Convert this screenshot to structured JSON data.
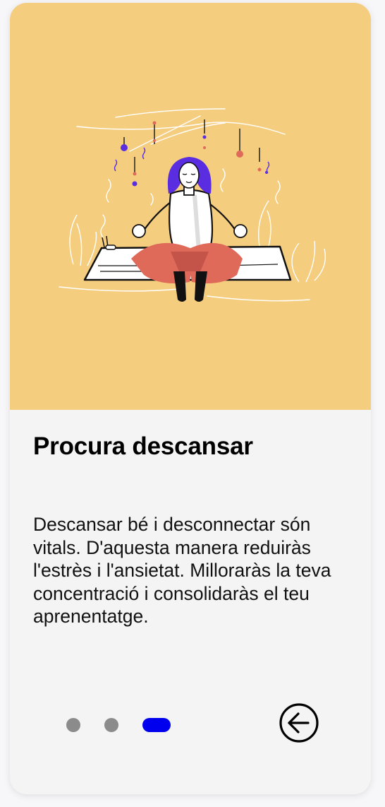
{
  "slide": {
    "title": "Procura descansar",
    "description": "Descansar bé i desconnectar són vitals. D'aquesta manera reduiràs l'estrès i l'ansietat. Milloraràs la teva concentració i consolidaràs el teu aprenentatge."
  },
  "pager": {
    "total": 3,
    "active_index": 2
  },
  "icons": {
    "back": "arrow-left-circle-icon",
    "illustration": "meditation-illustration"
  },
  "colors": {
    "hero_background": "#f5cd7f",
    "card_background": "#f4f4f4",
    "dot_inactive": "#8b8b8b",
    "dot_active": "#0000ee",
    "hair": "#5a2ee0",
    "pants": "#e06a5a"
  }
}
